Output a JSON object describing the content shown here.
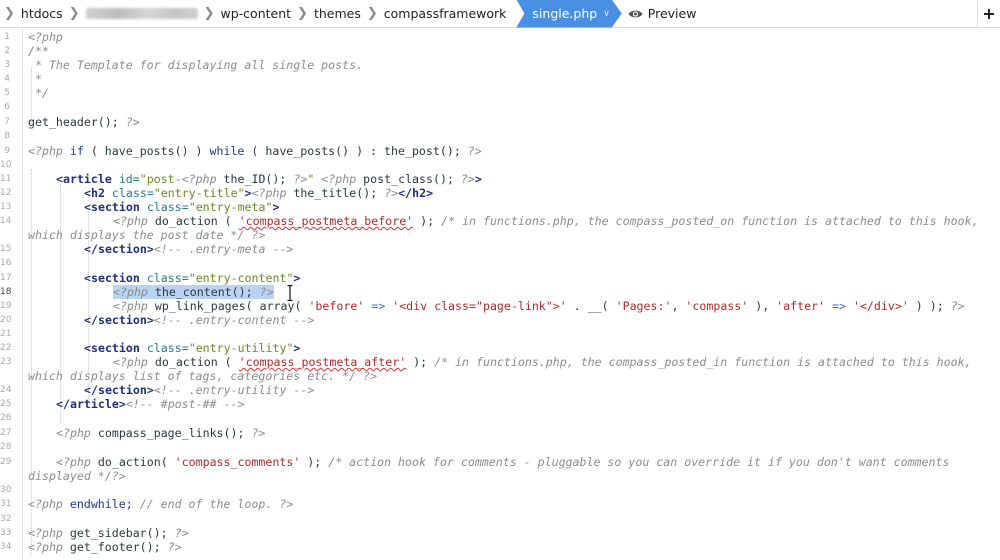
{
  "breadcrumb": {
    "items": [
      "htdocs",
      "[redacted]",
      "wp-content",
      "themes",
      "compassframework"
    ],
    "active_file": "single.php",
    "preview_label": "Preview",
    "add_label": "+"
  },
  "colors": {
    "active_tab": "#4a90e2",
    "keyword": "#1f3a8a",
    "string": "#b22a2a",
    "html_attr_value": "#6a8a1f",
    "comment": "#8c8c8c",
    "selection": "#b9d4f2"
  },
  "editor": {
    "current_line": 18,
    "selected_text": "<?php the_content(); ?>",
    "line_numbers": [
      "1",
      "2",
      "3",
      "4",
      "5",
      "6",
      "7",
      "8",
      "9",
      "10",
      "11",
      "12",
      "13",
      "14",
      "15",
      "16",
      "17",
      "18",
      "19",
      "20",
      "21",
      "22",
      "23",
      "24",
      "25",
      "26",
      "27",
      "28",
      "29",
      "30",
      "31",
      "32",
      "33",
      "34"
    ],
    "lines": {
      "l1": "<?php",
      "l2": "/**",
      "l3": " * The Template for displaying all single posts.",
      "l4": " *",
      "l5": " */",
      "l7a": "get_header();",
      "l7b": " ?>",
      "l9a": "<?php",
      "l9b": " if",
      "l9c": " ( have_posts() )",
      "l9d": " while",
      "l9e": " ( have_posts() ) : the_post();",
      "l9f": " ?>",
      "l11a": "<article",
      "l11b": " id=",
      "l11c": "\"post-",
      "l11d": "<?php",
      "l11e": " the_ID();",
      "l11f": " ?>",
      "l11g": "\"",
      "l11h": " <?php",
      "l11i": " post_class();",
      "l11j": " ?>",
      "l11k": ">",
      "l12a": "<h2",
      "l12b": " class=",
      "l12c": "\"entry-title\"",
      "l12d": ">",
      "l12e": "<?php",
      "l12f": " the_title();",
      "l12g": " ?>",
      "l12h": "</h2>",
      "l13a": "<section",
      "l13b": " class=",
      "l13c": "\"entry-meta\"",
      "l13d": ">",
      "l14a": "<?php",
      "l14b": " do_action ( ",
      "l14c": "'compass_postmeta_before'",
      "l14d": " ); ",
      "l14e": "/* in functions.php, the compass_posted_on function is attached to this hook,",
      "l14w": "which displays the post date */ ?>",
      "l15a": "</section>",
      "l15b": "<!-- .entry-meta -->",
      "l17a": "<section",
      "l17b": " class=",
      "l17c": "\"entry-content\"",
      "l17d": ">",
      "l18a": "<?php",
      "l18b": " the_content();",
      "l18c": " ?>",
      "l19a": "<?php",
      "l19b": " wp_link_pages( array( ",
      "l19c": "'before'",
      "l19d": " => ",
      "l19e": "'<div class=\"page-link\">'",
      "l19f": " . __( ",
      "l19g": "'Pages:'",
      "l19h": ", ",
      "l19i": "'compass'",
      "l19j": " ), ",
      "l19k": "'after'",
      "l19l": " => ",
      "l19m": "'</div>'",
      "l19n": " ) );",
      "l19o": " ?>",
      "l20a": "</section>",
      "l20b": "<!-- .entry-content -->",
      "l22a": "<section",
      "l22b": " class=",
      "l22c": "\"entry-utility\"",
      "l22d": ">",
      "l23a": "<?php",
      "l23b": " do_action ( ",
      "l23c": "'compass_postmeta_after'",
      "l23d": " ); ",
      "l23e": "/* in functions.php, the compass_posted_in function is attached to this hook,",
      "l23w": "which displays list of tags, categories etc. */ ?>",
      "l24a": "</section>",
      "l24b": "<!-- .entry-utility -->",
      "l25a": "</article>",
      "l25b": "<!-- #post-## -->",
      "l27a": "<?php",
      "l27b": " compass_page_links();",
      "l27c": " ?>",
      "l29a": "<?php",
      "l29b": " do_action( ",
      "l29c": "'compass_comments'",
      "l29d": " ); ",
      "l29e": "/* action hook for comments - pluggable so you can override it if you don't want comments",
      "l29w": "displayed */?>",
      "l31a": "<?php",
      "l31b": " endwhile;",
      "l31c": " // end of the loop. ?>",
      "l33a": "<?php",
      "l33b": " get_sidebar();",
      "l33c": " ?>",
      "l34a": "<?php",
      "l34b": " get_footer();",
      "l34c": " ?>"
    }
  }
}
